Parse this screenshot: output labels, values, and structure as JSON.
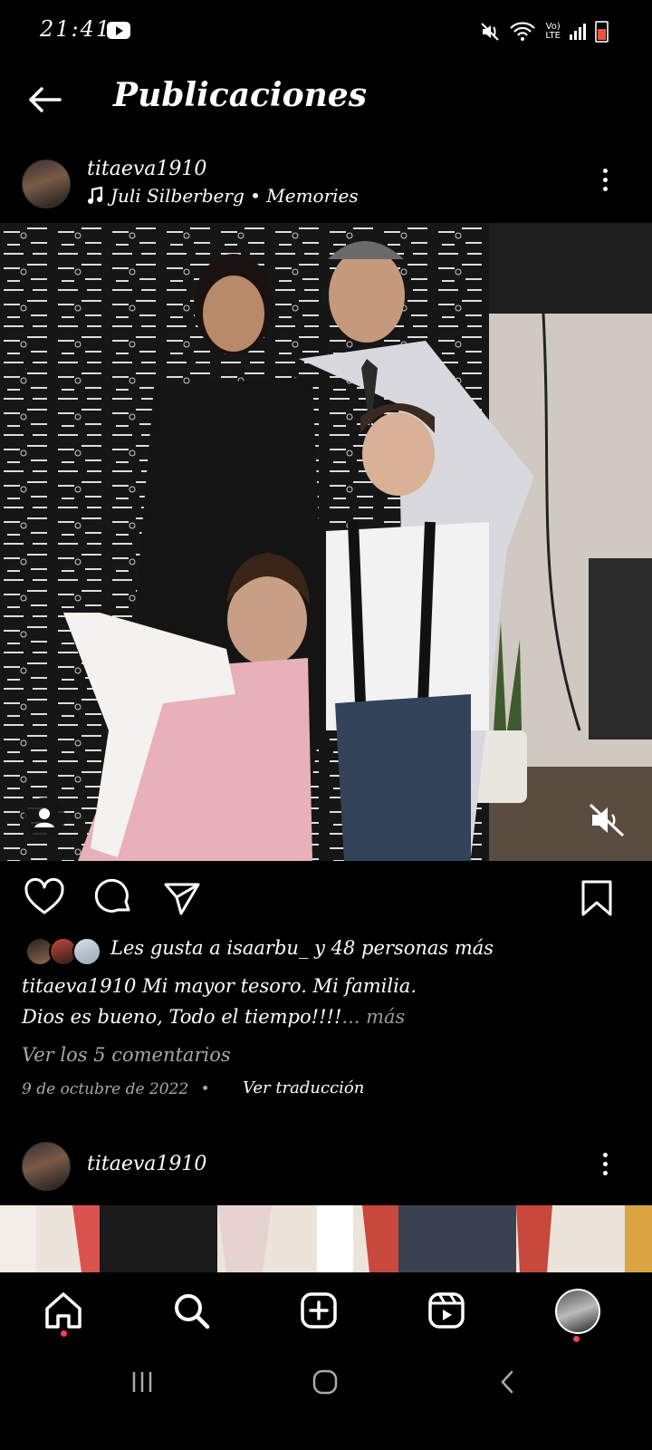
{
  "status_bar": {
    "time": "21:41",
    "network_label_top": "Vo)",
    "network_label_bottom": "LTE"
  },
  "header": {
    "title": "Publicaciones"
  },
  "post": {
    "username": "titaeva1910",
    "music": "Juli Silberberg • Memories",
    "likes_text": "Les gusta a isaarbu_ y 48 personas más",
    "caption_user": "titaeva1910",
    "caption_line1": "Mi mayor tesoro. Mi familia.",
    "caption_line2": "Dios es bueno, Todo el tiempo!!!!",
    "caption_more": "... más",
    "comments_link": "Ver los 5 comentarios",
    "date": "9 de octubre de 2022",
    "separator": "•",
    "translate_link": "Ver traducción"
  },
  "next_post": {
    "username": "titaeva1910"
  },
  "icons": [
    "back-arrow-icon",
    "music-note-icon",
    "more-options-icon",
    "user-tag-icon",
    "muted-speaker-icon",
    "heart-icon",
    "comment-icon",
    "send-icon",
    "bookmark-icon",
    "home-icon",
    "search-icon",
    "create-icon",
    "reels-icon",
    "profile-icon"
  ],
  "colors": {
    "background": "#000000",
    "notification_dot": "#f33e58",
    "secondary_text": "#a8a8a8"
  }
}
